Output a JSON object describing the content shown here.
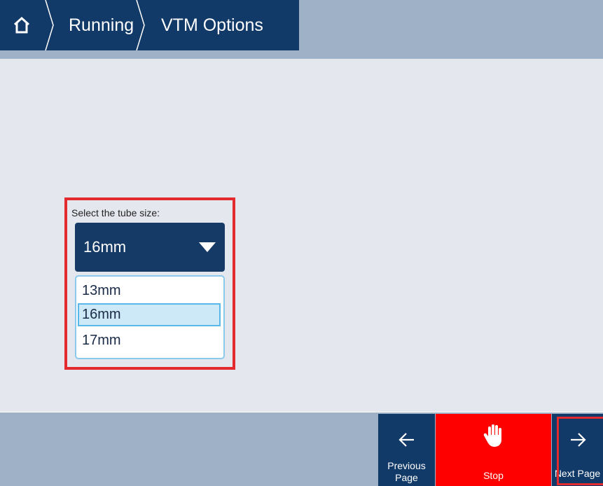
{
  "breadcrumb": {
    "home_icon": "home-icon",
    "items": [
      "Running",
      "VTM Options"
    ]
  },
  "tube_selector": {
    "label": "Select the tube size:",
    "selected": "16mm",
    "options": [
      "13mm",
      "16mm",
      "17mm"
    ],
    "highlighted_option": "16mm"
  },
  "footer": {
    "previous_label_line1": "Previous",
    "previous_label_line2": "Page",
    "previous_icon": "arrow-left-icon",
    "stop_label": "Stop",
    "stop_icon": "hand-stop-icon",
    "next_label": "Next Page",
    "next_icon": "arrow-right-icon"
  },
  "colors": {
    "navy": "#123a68",
    "slate": "#9eb1c6",
    "background": "#e5e7ee",
    "stop_red": "#ff0000",
    "highlight_frame": "#e22a2f",
    "option_selected_bg": "#cde8f7"
  }
}
